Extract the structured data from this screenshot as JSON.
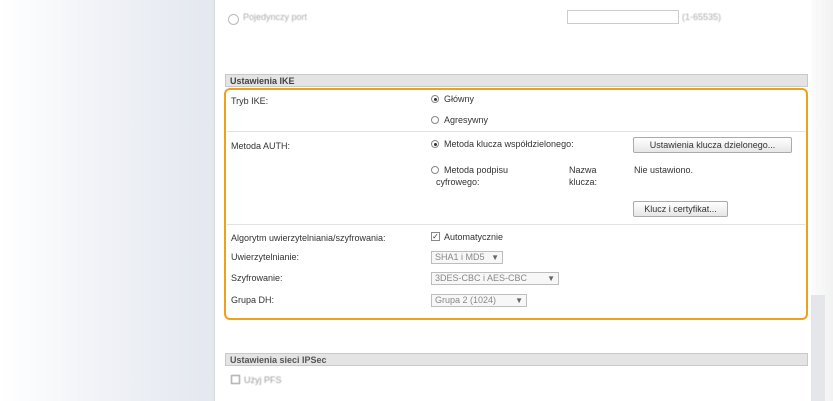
{
  "top": {
    "port_label": "Pojedynczy port",
    "port_range": "(1-65535)"
  },
  "ike": {
    "section_title": "Ustawienia IKE",
    "mode_label": "Tryb IKE:",
    "mode_options": [
      "Główny",
      "Agresywny"
    ],
    "mode_selected": "Główny",
    "auth_label": "Metoda AUTH:",
    "auth_psk_label": "Metoda klucza współdzielonego:",
    "psk_settings_button": "Ustawienia klucza dzielonego...",
    "auth_sig_label_1": "Metoda podpisu",
    "auth_sig_label_2": "cyfrowego:",
    "key_name_label_1": "Nazwa",
    "key_name_label_2": "klucza:",
    "key_name_value": "Nie ustawiono.",
    "key_cert_button": "Klucz i certyfikat...",
    "algo_label": "Algorytm uwierzytelniania/szyfrowania:",
    "auto_label": "Automatycznie",
    "auto_checked": true,
    "auth_field_label": "Uwierzytelnianie:",
    "auth_field_value": "SHA1 i MD5",
    "enc_label": "Szyfrowanie:",
    "enc_value": "3DES-CBC i AES-CBC",
    "dh_label": "Grupa DH:",
    "dh_value": "Grupa 2 (1024)",
    "accent_color": "#f0a01f"
  },
  "ipsec": {
    "section_title": "Ustawienia sieci IPSec",
    "pfs_label": "Użyj PFS"
  }
}
